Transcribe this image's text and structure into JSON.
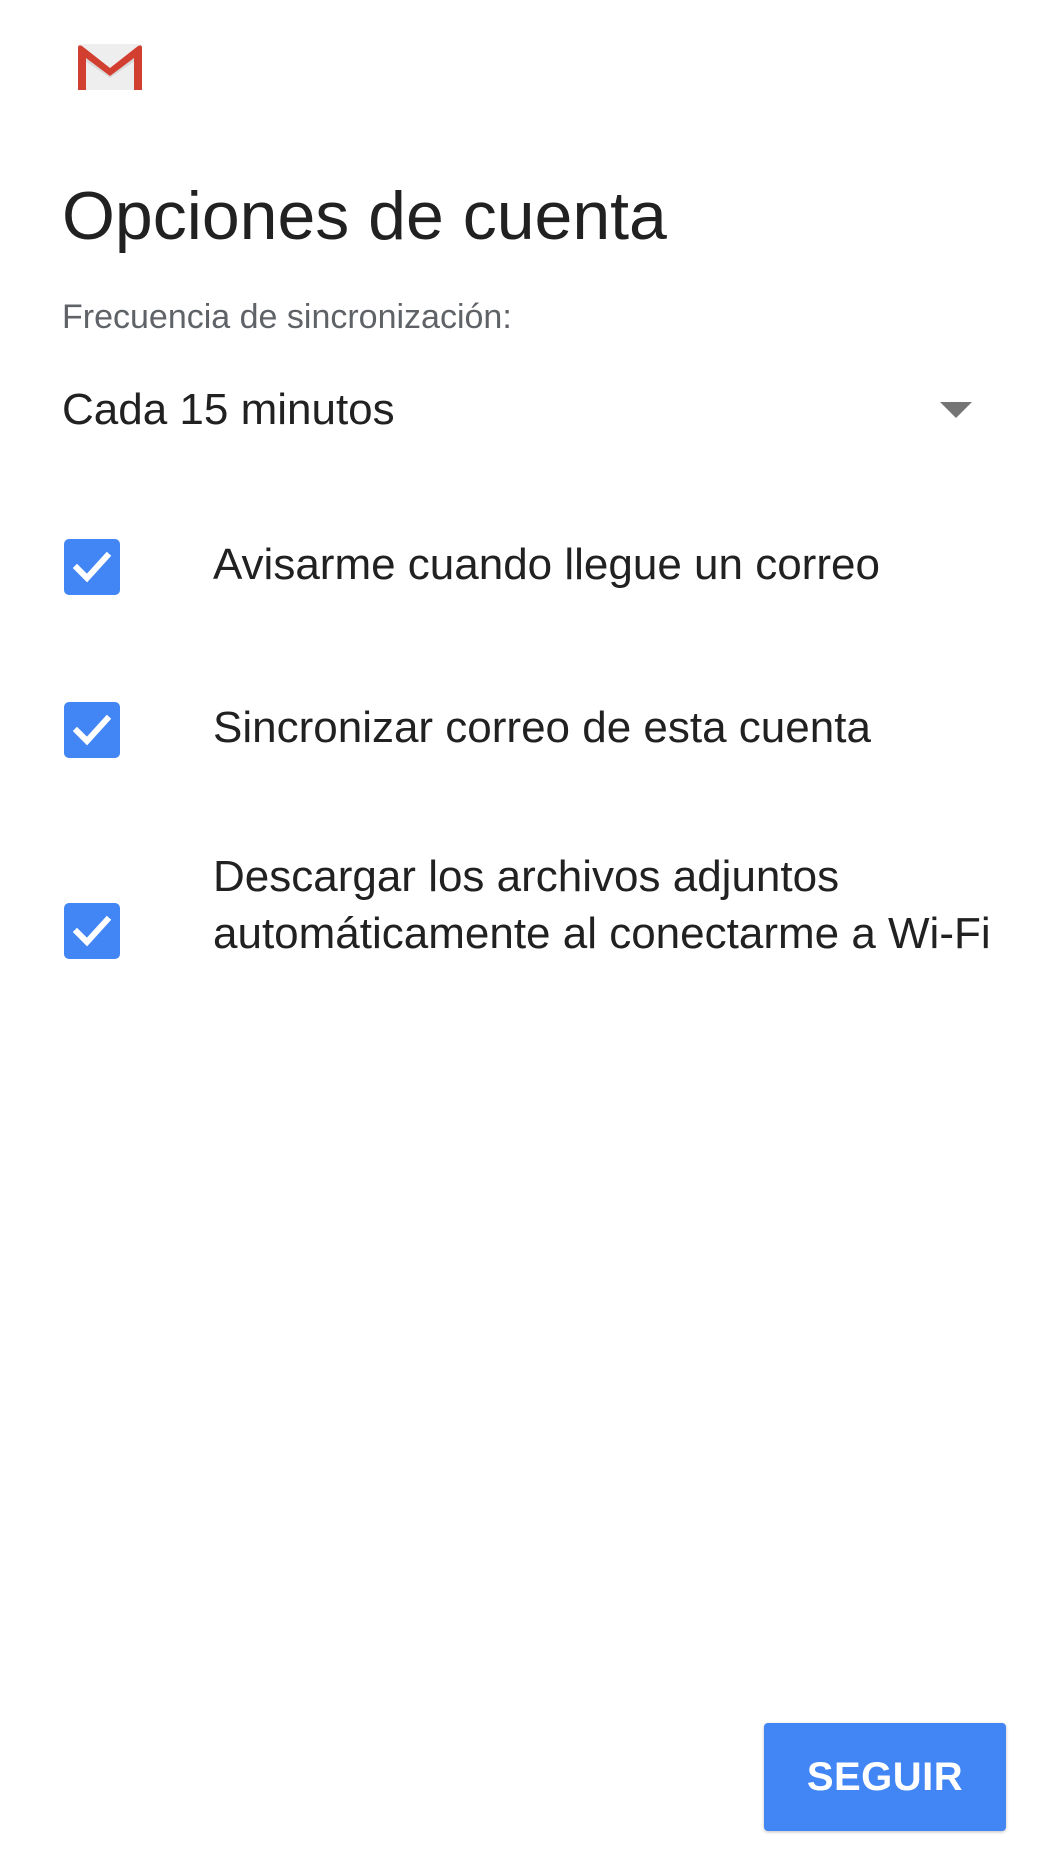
{
  "app": {
    "logo_icon": "gmail-logo-icon"
  },
  "header": {
    "title": "Opciones de cuenta"
  },
  "sync": {
    "label": "Frecuencia de sincronización:",
    "selected_value": "Cada 15 minutos",
    "arrow_icon": "dropdown-arrow-icon"
  },
  "options": [
    {
      "label": "Avisarme cuando llegue un correo",
      "checked": true
    },
    {
      "label": "Sincronizar correo de esta cuenta",
      "checked": true
    },
    {
      "label": "Descargar los archivos adjuntos automáticamente al conectarme a Wi-Fi",
      "checked": true
    }
  ],
  "footer": {
    "continue_label": "SEGUIR"
  },
  "colors": {
    "accent": "#4285f4",
    "gmail_red": "#d23f31",
    "text_primary": "#212121",
    "text_secondary": "#5f6368"
  }
}
